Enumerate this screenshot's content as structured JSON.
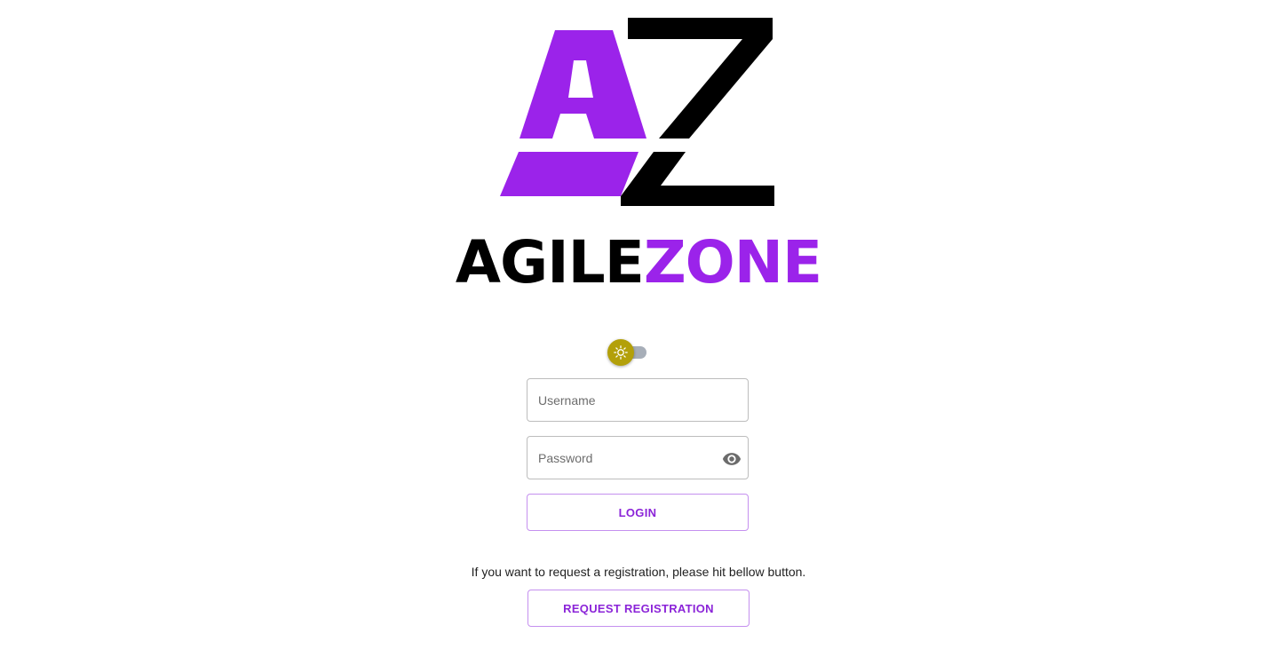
{
  "brand": {
    "logo_letters": "AZ",
    "word_first": "AGILE",
    "word_second": "ZONE",
    "colors": {
      "purple": "#9b23ea",
      "black": "#000000"
    }
  },
  "theme_toggle": {
    "icon": "sun-icon",
    "state": "light",
    "thumb_color": "#b3a00a"
  },
  "login_form": {
    "username_placeholder": "Username",
    "password_placeholder": "Password",
    "visibility_icon": "eye-icon",
    "login_label": "LOGIN"
  },
  "registration": {
    "note": "If you want to request a registration, please hit bellow button.",
    "button_label": "REQUEST REGISTRATION"
  },
  "accent_color": "#8b24d8"
}
